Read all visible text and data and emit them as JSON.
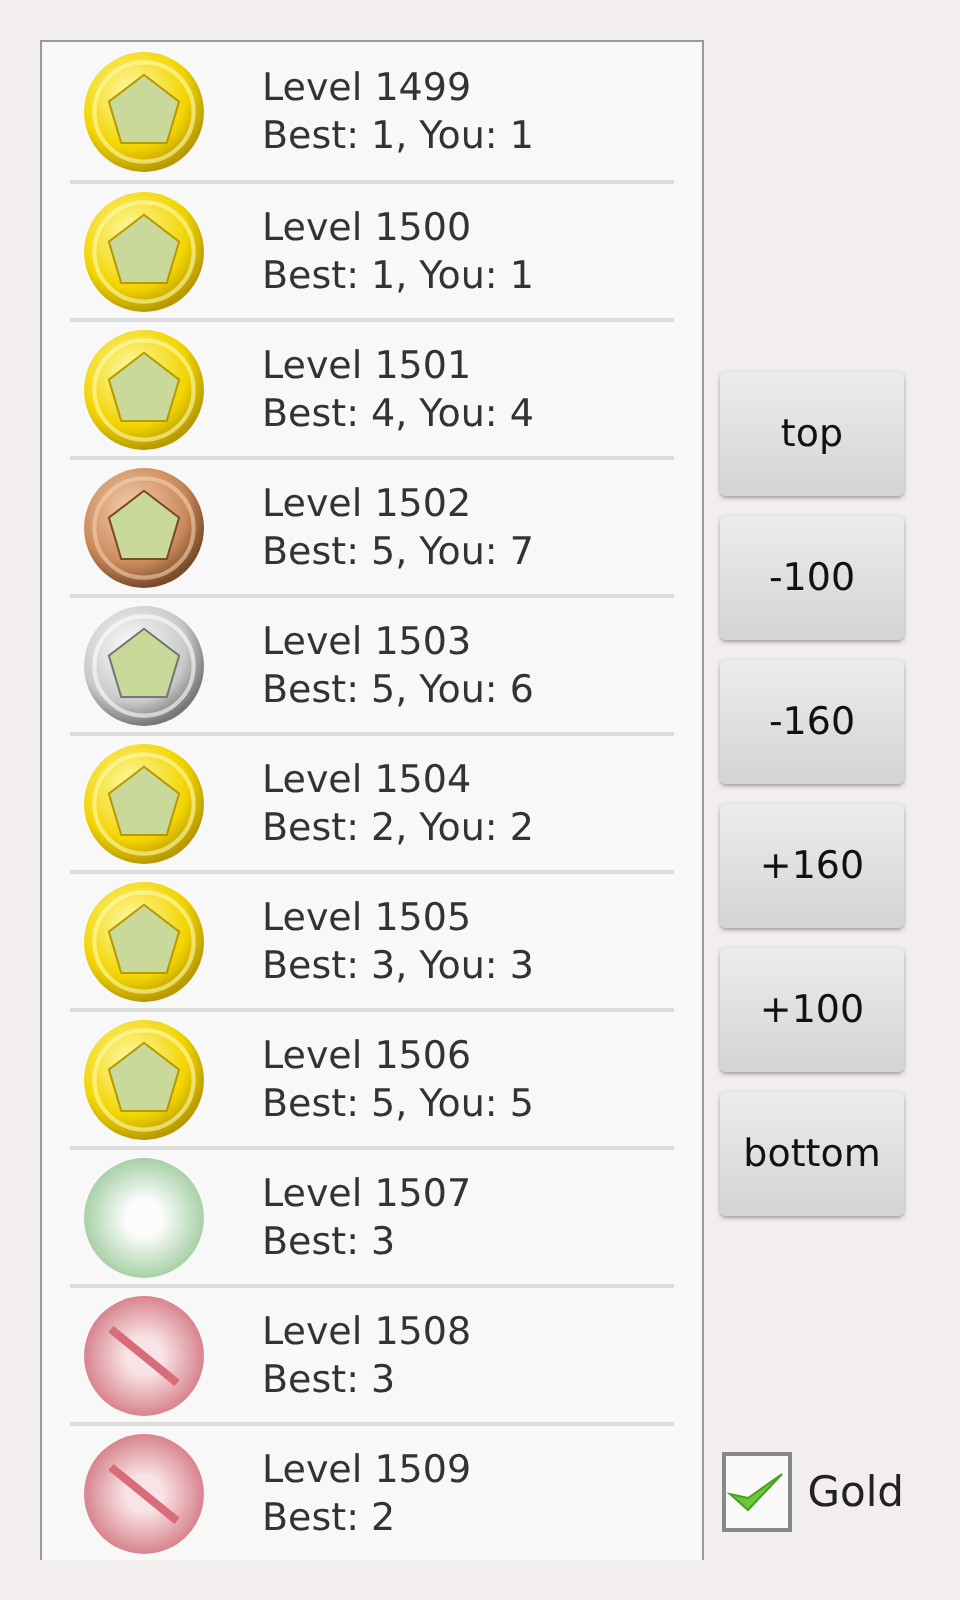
{
  "levels": [
    {
      "kind": "gold",
      "title": "Level 1499",
      "score": "Best: 1, You: 1"
    },
    {
      "kind": "gold",
      "title": "Level 1500",
      "score": "Best: 1, You: 1"
    },
    {
      "kind": "gold",
      "title": "Level 1501",
      "score": "Best: 4, You: 4"
    },
    {
      "kind": "bronze",
      "title": "Level 1502",
      "score": "Best: 5, You: 7"
    },
    {
      "kind": "silver",
      "title": "Level 1503",
      "score": "Best: 5, You: 6"
    },
    {
      "kind": "gold",
      "title": "Level 1504",
      "score": "Best: 2, You: 2"
    },
    {
      "kind": "gold",
      "title": "Level 1505",
      "score": "Best: 3, You: 3"
    },
    {
      "kind": "gold",
      "title": "Level 1506",
      "score": "Best: 5, You: 5"
    },
    {
      "kind": "open",
      "title": "Level 1507",
      "score": "Best: 3"
    },
    {
      "kind": "locked",
      "title": "Level 1508",
      "score": "Best: 3"
    },
    {
      "kind": "locked",
      "title": "Level 1509",
      "score": "Best: 2"
    }
  ],
  "buttons": [
    "top",
    "-100",
    "-160",
    "+160",
    "+100",
    "bottom"
  ],
  "gold_filter": {
    "label": "Gold",
    "checked": true
  }
}
